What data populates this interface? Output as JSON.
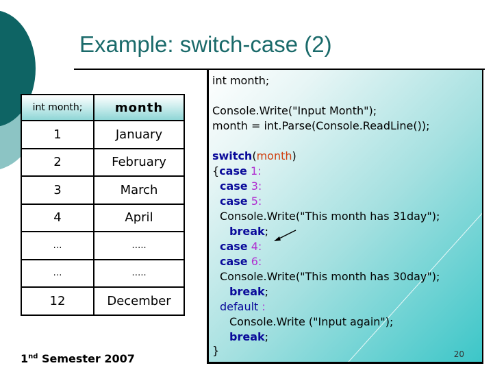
{
  "slide": {
    "title": "Example: switch-case (2)",
    "page_number": "20",
    "footer": {
      "prefix": "1",
      "superscript": "nd",
      "text": " Semester 2007"
    }
  },
  "table": {
    "headers": [
      "int month;",
      "month"
    ],
    "rows": [
      [
        "1",
        "January"
      ],
      [
        "2",
        "February"
      ],
      [
        "3",
        "March"
      ],
      [
        "4",
        "April"
      ],
      [
        "…",
        "….."
      ],
      [
        "…",
        "….."
      ],
      [
        "12",
        "December"
      ]
    ]
  },
  "code": {
    "line1": "int month;",
    "line2": "Console.Write(\"Input Month\");",
    "line3": "month = int.Parse(Console.ReadLine());",
    "switch_kw": "switch",
    "switch_open": "(",
    "switch_var": "month",
    "switch_close": ")",
    "brace_open": "{",
    "case_kw": "case",
    "case_values": [
      "1:",
      "3:",
      "5:",
      "4:",
      "6:"
    ],
    "write31": "Console.Write(\"This month has 31day\");",
    "write30": "Console.Write(\"This month has 30day\");",
    "break_kw": "break",
    "semicolon": ";",
    "default_kw": "default",
    "default_colon": " :",
    "write_again": "Console.Write (\"Input again\");",
    "brace_close": "}"
  },
  "colors": {
    "title": "#1a6a6a",
    "keyword": "#0a0a9a",
    "number": "#b030d0",
    "variable": "#d04010"
  }
}
